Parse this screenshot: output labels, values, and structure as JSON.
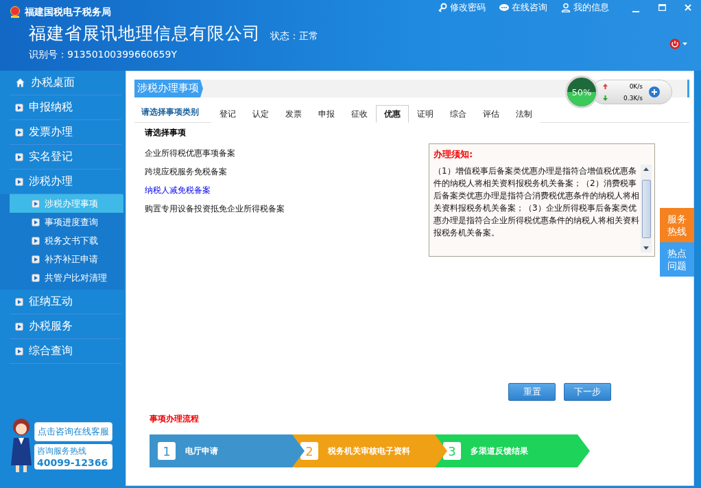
{
  "window": {
    "app_name": "福建国税电子税务局",
    "links": [
      {
        "label": "修改密码",
        "kind": "key"
      },
      {
        "label": "在线咨询",
        "kind": "chat"
      },
      {
        "label": "我的信息",
        "kind": "user"
      }
    ]
  },
  "company": {
    "name": "福建省展讯地理信息有限公司",
    "status_label": "状态：",
    "status": "正常",
    "id_label": "识别号：",
    "id": "91350100399660659Y"
  },
  "sidebar": {
    "items": [
      {
        "label": "办税桌面",
        "kind": "home"
      },
      {
        "label": "申报纳税",
        "kind": "arrow"
      },
      {
        "label": "发票办理",
        "kind": "arrow"
      },
      {
        "label": "实名登记",
        "kind": "arrow"
      },
      {
        "label": "涉税办理",
        "kind": "arrow",
        "children": [
          {
            "label": "涉税办理事项",
            "selected": true
          },
          {
            "label": "事项进度查询",
            "selected": false
          },
          {
            "label": "税务文书下载",
            "selected": false
          },
          {
            "label": "补齐补正申请",
            "selected": false
          },
          {
            "label": "共管户比对清理",
            "selected": false
          }
        ]
      },
      {
        "label": "征纳互动",
        "kind": "arrow"
      },
      {
        "label": "办税服务",
        "kind": "arrow"
      },
      {
        "label": "综合查询",
        "kind": "arrow"
      }
    ],
    "promo": {
      "consult": "点击咨询在线客服",
      "hotline_label": "咨询服务热线",
      "hotline": "40099-12366"
    }
  },
  "main": {
    "title": "涉税办理事项",
    "category_label": "请选择事项类别",
    "tabs": [
      {
        "label": "登记",
        "selected": false
      },
      {
        "label": "认定",
        "selected": false
      },
      {
        "label": "发票",
        "selected": false
      },
      {
        "label": "申报",
        "selected": false
      },
      {
        "label": "征收",
        "selected": false
      },
      {
        "label": "优惠",
        "selected": true
      },
      {
        "label": "证明",
        "selected": false
      },
      {
        "label": "综合",
        "selected": false
      },
      {
        "label": "评估",
        "selected": false
      },
      {
        "label": "法制",
        "selected": false
      }
    ],
    "items_heading": "请选择事项",
    "items": [
      {
        "label": "企业所得税优惠事项备案",
        "selected": false
      },
      {
        "label": "跨境应税服务免税备案",
        "selected": false
      },
      {
        "label": "纳税人减免税备案",
        "selected": true
      },
      {
        "label": "购置专用设备投资抵免企业所得税备案",
        "selected": false
      }
    ],
    "notice": {
      "title": "办理须知:",
      "text": "（1）增值税事后备案类优惠办理是指符合增值税优惠条件的纳税人将相关资料报税务机关备案；（2）消费税事后备案类优惠办理是指符合消费税优惠条件的纳税人将相关资料报税务机关备案；（3）企业所得税事后备案类优惠办理是指符合企业所得税优惠条件的纳税人将相关资料报税务机关备案。"
    },
    "buttons": [
      "重置",
      "下一步"
    ],
    "process_title": "事项办理流程",
    "steps": [
      {
        "number": "1",
        "label": "电厅申请",
        "color": "#3d94cc"
      },
      {
        "number": "2",
        "label": "税务机关审核电子资料",
        "color": "#f0a014"
      },
      {
        "number": "3",
        "label": "多渠道反馈结果",
        "color": "#1ed35a"
      }
    ]
  },
  "speed_widget": {
    "percent": "50%",
    "up": "0K/s",
    "down": "0.3K/s"
  },
  "side_tabs": [
    {
      "label": "服务热线",
      "color": "#f5821f"
    },
    {
      "label": "热点问题",
      "color": "#3d9ff0"
    }
  ]
}
